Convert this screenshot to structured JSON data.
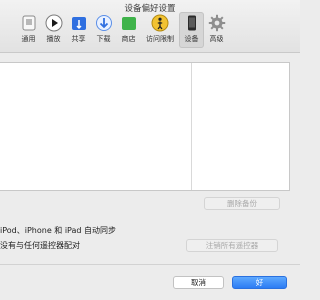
{
  "window": {
    "title": "设备偏好设置"
  },
  "toolbar": {
    "items": [
      {
        "label": "通用",
        "icon": "general-icon"
      },
      {
        "label": "播放",
        "icon": "play-icon"
      },
      {
        "label": "共享",
        "icon": "sharing-icon"
      },
      {
        "label": "下载",
        "icon": "download-icon"
      },
      {
        "label": "商店",
        "icon": "store-icon"
      },
      {
        "label": "访问限制",
        "icon": "restrictions-icon"
      },
      {
        "label": "设备",
        "icon": "device-icon",
        "selected": true
      },
      {
        "label": "高级",
        "icon": "gear-icon"
      }
    ]
  },
  "devices": {
    "delete_backup_label": "删除备份"
  },
  "options": {
    "sync_text": "iPod、iPhone 和 iPad 自动同步",
    "remote_text": "没有与任何遥控器配对",
    "unpair_label": "注销所有遥控器"
  },
  "footer": {
    "cancel_label": "取消",
    "ok_label": "好"
  },
  "colors": {
    "accent": "#2c7cf4",
    "selected_tab_bg": "#d6d6d6"
  }
}
